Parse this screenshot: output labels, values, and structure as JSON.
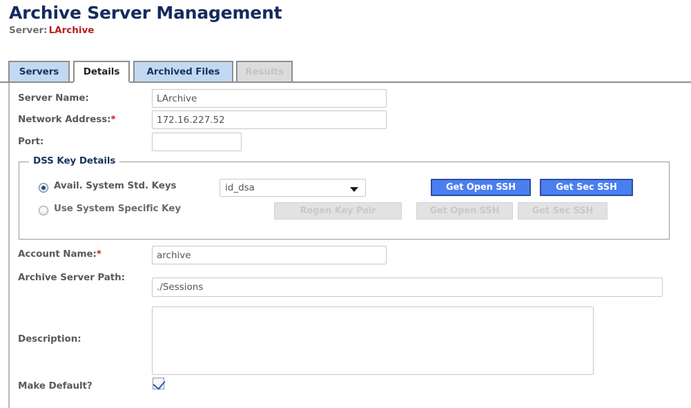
{
  "header": {
    "title": "Archive Server Management",
    "server_label": "Server:",
    "server_value": "LArchive"
  },
  "tabs": [
    {
      "id": "servers",
      "label": "Servers",
      "state": "normal"
    },
    {
      "id": "details",
      "label": "Details",
      "state": "selected"
    },
    {
      "id": "archived",
      "label": "Archived Files",
      "state": "normal"
    },
    {
      "id": "results",
      "label": "Results",
      "state": "disabled"
    }
  ],
  "form": {
    "server_name": {
      "label": "Server Name:",
      "value": "LArchive",
      "required": false
    },
    "network_address": {
      "label": "Network Address:",
      "required_mark": "*",
      "value": "172.16.227.52",
      "required": true
    },
    "port": {
      "label": "Port:",
      "value": "",
      "placeholder": "",
      "required": false
    },
    "account_name": {
      "label": "Account Name:",
      "required_mark": "*",
      "value": "archive",
      "required": true
    },
    "archive_server_path": {
      "label": "Archive Server Path:",
      "value": "./Sessions",
      "required": false
    },
    "description": {
      "label": "Description:",
      "value": "",
      "placeholder": "",
      "required": false
    },
    "make_default": {
      "label": "Make Default?",
      "checked": true
    }
  },
  "dss_key_details": {
    "legend": "DSS Key Details",
    "options": [
      {
        "id": "std",
        "label": "Avail. System Std. Keys",
        "selected": true
      },
      {
        "id": "specific",
        "label": "Use System Specific Key",
        "selected": false
      }
    ],
    "key_select": {
      "value": "id_dsa",
      "arrow_icon": "chevron-down-icon"
    },
    "buttons": {
      "get_open_ssh": "Get Open SSH",
      "get_sec_ssh": "Get Sec SSH",
      "regen_key_pair": "Regen Key Pair",
      "get_open_ssh_disabled": "Get Open SSH",
      "get_sec_ssh_disabled": "Get Sec SSH"
    }
  },
  "colors": {
    "title": "#152b5e",
    "server_value": "#b52020",
    "tab_active": "#c3d9f1",
    "tab_disabled": "#dcdcdc",
    "button_primary": "#4b7ef0",
    "button_primary_border": "#2b4f9e",
    "required_mark": "#c02020",
    "legend": "#17355f"
  }
}
